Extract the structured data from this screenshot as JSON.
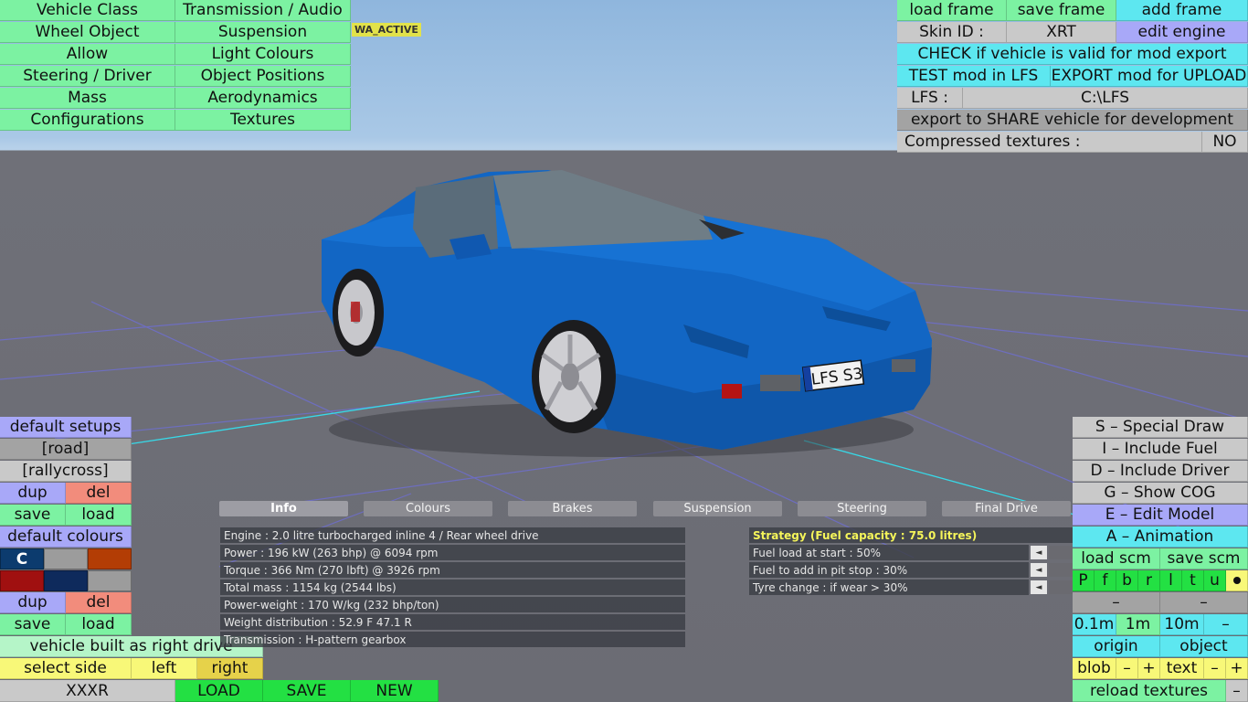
{
  "tag": "WA_ACTIVE",
  "top_menu": {
    "col1": [
      "Vehicle Class",
      "Wheel Object",
      "Allow",
      "Steering / Driver",
      "Mass",
      "Configurations"
    ],
    "col2": [
      "Transmission / Audio",
      "Suspension",
      "Light Colours",
      "Object Positions",
      "Aerodynamics",
      "Textures"
    ]
  },
  "top_right": {
    "load_frame": "load frame",
    "save_frame": "save frame",
    "add_frame": "add frame",
    "skin_id_label": "Skin ID :",
    "skin_id_value": "XRT",
    "edit_engine": "edit engine",
    "check_valid": "CHECK if vehicle is valid for mod export",
    "test_mod": "TEST mod in LFS",
    "export_mod": "EXPORT mod for UPLOAD",
    "lfs_label": "LFS :",
    "lfs_path": "C:\\LFS",
    "export_share": "export to SHARE vehicle for development",
    "compressed_label": "Compressed textures :",
    "compressed_value": "NO"
  },
  "car": {
    "plate": "LFS S3"
  },
  "left_panel": {
    "default_setups": "default setups",
    "road": "[road]",
    "rallycross": "[rallycross]",
    "dup": "dup",
    "del": "del",
    "save": "save",
    "load": "load",
    "default_colours": "default colours",
    "swatch_c": "C",
    "dup2": "dup",
    "del2": "del",
    "save2": "save",
    "load2": "load",
    "right_drive": "vehicle built as right drive",
    "select_side": "select side",
    "left": "left",
    "right": "right"
  },
  "colors": {
    "swatch_1": "#0c3b6e",
    "swatch_2": "#9c9c9c",
    "swatch_3": "#b33d05",
    "swatch_4": "#a01010",
    "swatch_5": "#0e2a5c",
    "swatch_6": "#9c9c9c",
    "car_body": "#1266c4"
  },
  "bottom_bar": {
    "name": "XXXR",
    "load": "LOAD",
    "save": "SAVE",
    "new": "NEW"
  },
  "tabs": [
    "Info",
    "Colours",
    "Brakes",
    "Suspension",
    "Steering",
    "Final Drive"
  ],
  "info": [
    "Engine : 2.0 litre turbocharged inline 4 / Rear wheel drive",
    "Power : 196 kW (263 bhp) @ 6094 rpm",
    "Torque : 366 Nm (270 lbft) @ 3926 rpm",
    "Total mass : 1154 kg (2544 lbs)",
    "Power-weight : 170 W/kg (232 bhp/ton)",
    "Weight distribution : 52.9 F  47.1 R",
    "Transmission : H-pattern gearbox"
  ],
  "strategy": {
    "title": "Strategy (Fuel capacity : 75.0 litres)",
    "rows": [
      "Fuel load at start : 50%",
      "Fuel to add in pit stop : 30%",
      "Tyre change : if wear > 30%"
    ],
    "arrow": "◄"
  },
  "right_panel": {
    "special_draw": "S – Special Draw",
    "include_fuel": "I – Include Fuel",
    "include_driver": "D – Include Driver",
    "show_cog": "G – Show COG",
    "edit_model": "E – Edit Model",
    "animation": "A – Animation",
    "load_scm": "load scm",
    "save_scm": "save scm",
    "letters": [
      "P",
      "f",
      "b",
      "r",
      "l",
      "t",
      "u"
    ],
    "dash": "–",
    "step_01": "0.1m",
    "step_1": "1m",
    "step_10": "10m",
    "minus": "–",
    "origin": "origin",
    "object": "object",
    "blob": "blob",
    "plus": "+",
    "text": "text",
    "reload": "reload textures"
  }
}
